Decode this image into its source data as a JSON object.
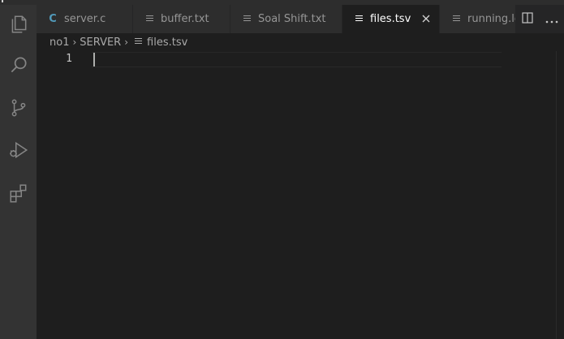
{
  "activity_bar": {
    "items": [
      "explorer-icon",
      "search-icon",
      "source-control-icon",
      "run-debug-icon",
      "extensions-icon"
    ]
  },
  "tabs": [
    {
      "label": "server.c",
      "icon": "c-file-icon",
      "icon_text": "C",
      "active": false
    },
    {
      "label": "buffer.txt",
      "icon": "text-file-icon",
      "active": false
    },
    {
      "label": "Soal Shift.txt",
      "icon": "text-file-icon",
      "active": false
    },
    {
      "label": "files.tsv",
      "icon": "text-file-icon",
      "active": true
    },
    {
      "label": "running.log",
      "icon": "text-file-icon",
      "active": false
    }
  ],
  "tab_actions": [
    "split-editor-icon",
    "more-actions-icon"
  ],
  "breadcrumb": {
    "items": [
      "no1",
      "SERVER",
      "files.tsv"
    ]
  },
  "editor": {
    "line_numbers": [
      "1"
    ],
    "content": ""
  },
  "colors": {
    "accent_c": "#519aba",
    "active_tab_bg": "#1e1e1e",
    "inactive_tab_bg": "#2d2d2d",
    "activity_bg": "#333333"
  }
}
